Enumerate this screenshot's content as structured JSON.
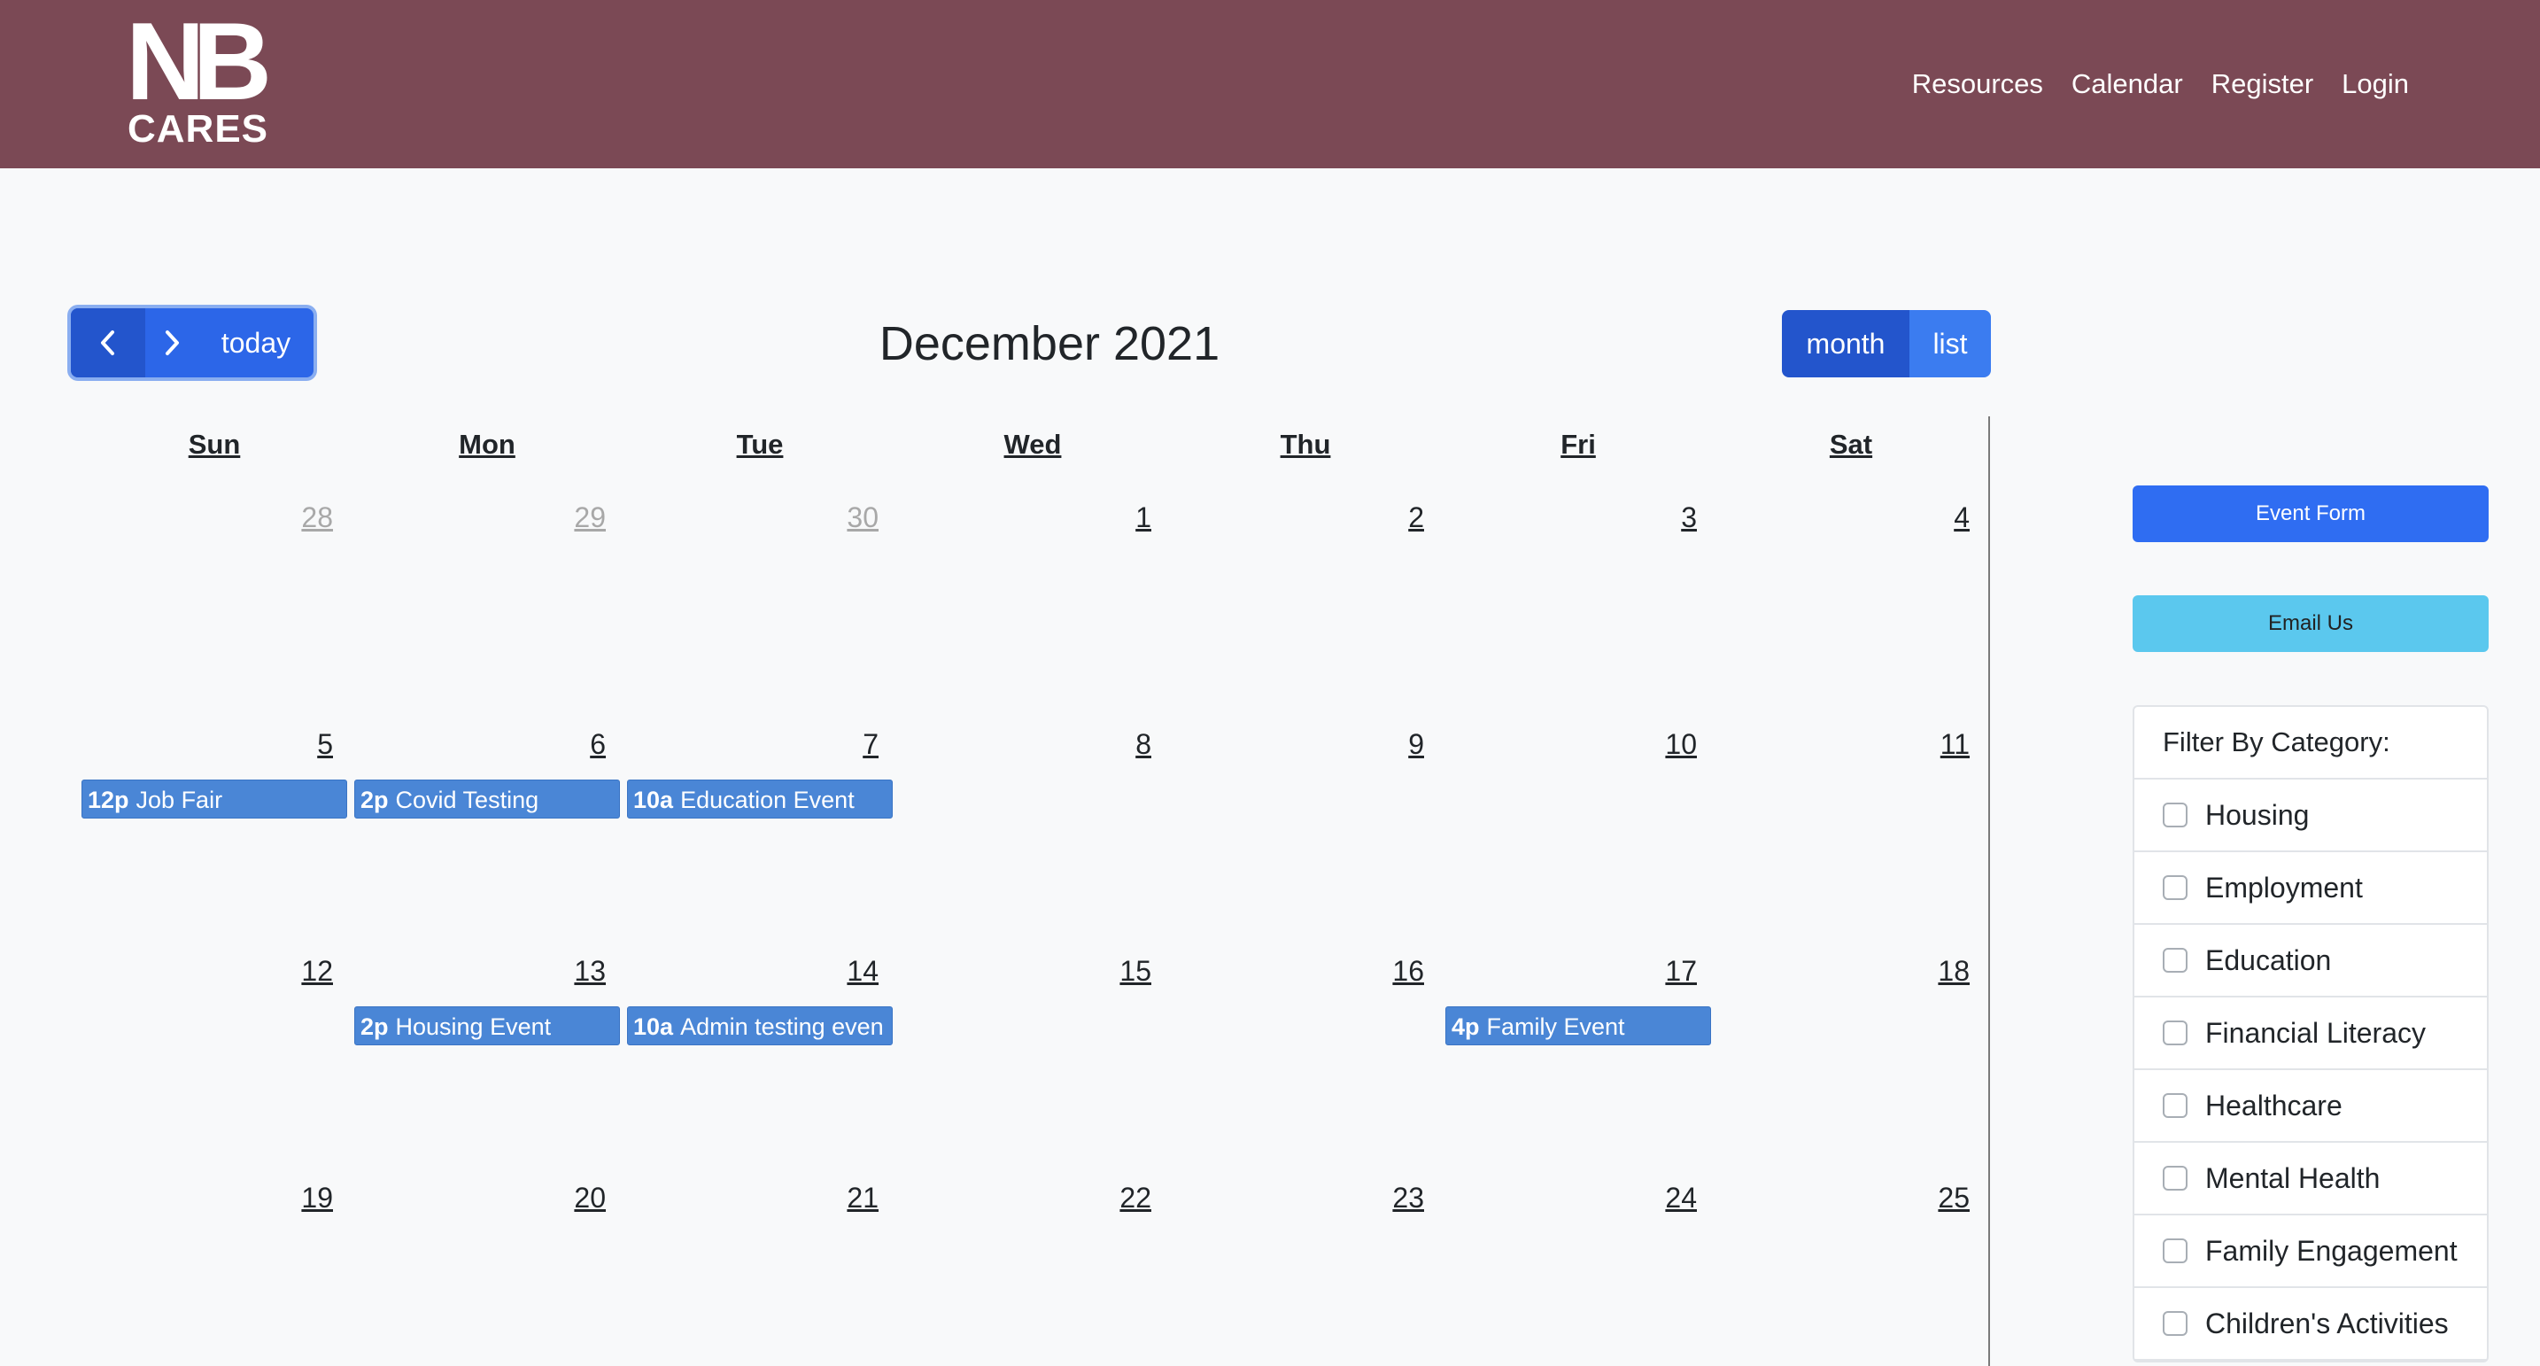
{
  "brand": {
    "logo_top": "NB",
    "logo_bottom": "CARES"
  },
  "nav": {
    "items": [
      "Resources",
      "Calendar",
      "Register",
      "Login"
    ]
  },
  "toolbar": {
    "prev_icon": "chevron-left-icon",
    "next_icon": "chevron-right-icon",
    "today_label": "today",
    "title": "December 2021",
    "month_label": "month",
    "list_label": "list"
  },
  "calendar": {
    "weekdays": [
      "Sun",
      "Mon",
      "Tue",
      "Wed",
      "Thu",
      "Fri",
      "Sat"
    ],
    "weeks": [
      [
        "28",
        "29",
        "30",
        "1",
        "2",
        "3",
        "4"
      ],
      [
        "5",
        "6",
        "7",
        "8",
        "9",
        "10",
        "11"
      ],
      [
        "12",
        "13",
        "14",
        "15",
        "16",
        "17",
        "18"
      ],
      [
        "19",
        "20",
        "21",
        "22",
        "23",
        "24",
        "25"
      ]
    ],
    "events": [
      {
        "time": "12p",
        "title": "Job Fair"
      },
      {
        "time": "2p",
        "title": "Covid Testing"
      },
      {
        "time": "10a",
        "title": "Education Event"
      },
      {
        "time": "2p",
        "title": "Housing Event"
      },
      {
        "time": "10a",
        "title": "Admin testing even"
      },
      {
        "time": "4p",
        "title": "Family Event"
      }
    ]
  },
  "sidebar": {
    "event_form_label": "Event Form",
    "email_label": "Email Us",
    "filter_title": "Filter By Category:",
    "categories": [
      "Housing",
      "Employment",
      "Education",
      "Financial Literacy",
      "Healthcare",
      "Mental Health",
      "Family Engagement",
      "Children's Activities"
    ]
  },
  "colors": {
    "header": "#7b4955",
    "primary": "#2c66e8",
    "event": "#4a86d6",
    "info": "#5bc8ee"
  }
}
